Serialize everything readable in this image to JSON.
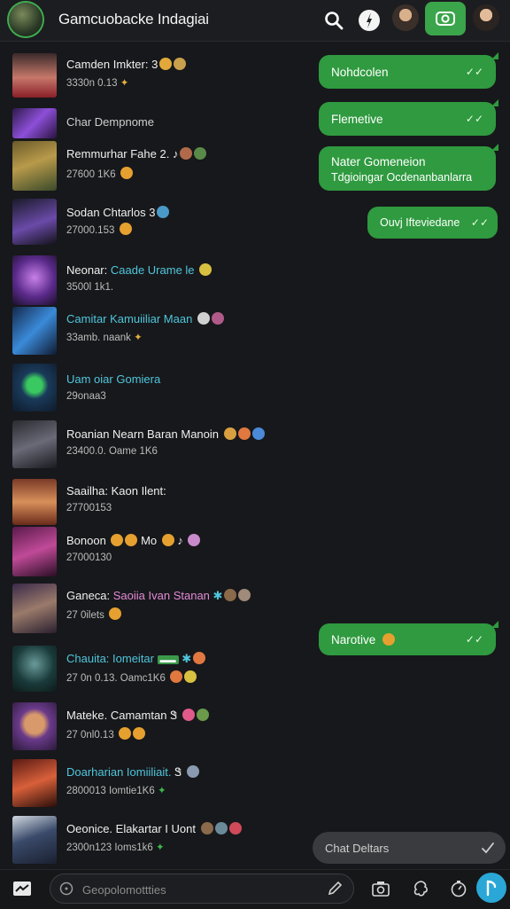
{
  "header": {
    "title": "Gamcuobacke Indagiai",
    "icons": [
      "search-icon",
      "compass-icon",
      "profile-avatar",
      "video-call-icon",
      "profile-avatar"
    ]
  },
  "chats": [
    {
      "name": "Camden Imkter:",
      "sub": "3330n 0.13",
      "thumb": "portrait-woman"
    },
    {
      "name": "Char Dempnome",
      "sub": "",
      "thumb": "purple-art"
    },
    {
      "name": "Remmurhar Fahe 2.",
      "sub": "27600 1K6",
      "thumb": "warrior-art"
    },
    {
      "name": "Sodan Chtarlos",
      "sub": "27000.153",
      "thumb": "weapon-art"
    },
    {
      "name": "Neonar: ",
      "name_accent": "Caade Urame le",
      "sub": "3500l 1k1.",
      "thumb": "mage-art"
    },
    {
      "name": "",
      "name_accent": "Camitar Kamuiiliar Maan",
      "sub": "33amb.   naank",
      "thumb": "lightning-art"
    },
    {
      "name": "",
      "name_accent": "Uam oiar Gomiera",
      "sub": "29onaa3",
      "thumb": "alien-art"
    },
    {
      "name": "Roanian Nearn Baran Manoin",
      "sub": "23400.0.   Oame 1K6",
      "thumb": "knight-art"
    },
    {
      "name": "Saailha: Kaon Ilent:",
      "sub": "27700153",
      "thumb": "soldier-art"
    },
    {
      "name": "Bonoon",
      "sub": "27000130",
      "thumb": "hero-art"
    },
    {
      "name": "Ganeca: ",
      "name_accent": "Saoiia Ivan Stanan",
      "sub": "27 0ilets",
      "thumb": "archer-art"
    },
    {
      "name": "",
      "name_accent": "Chauita: Iomeitar",
      "sub": "27 0n 0.13.   Oamc1K6",
      "thumb": "cyborg-art"
    },
    {
      "name": "Mateke. Camamtan",
      "sub": "27 0nl0.13",
      "thumb": "cartoon-art"
    },
    {
      "name": "",
      "name_accent": "Doarharian Iomiiliait.",
      "sub": "2800013   Iomtie1K6",
      "thumb": "fire-art"
    },
    {
      "name": "Oeonice. Elakartar I Uont",
      "sub": "2300n123   Ioms1k6",
      "thumb": "robot-art"
    }
  ],
  "bubbles": [
    {
      "line1": "Nohdcolen",
      "line2": "",
      "ticks": "✓✓"
    },
    {
      "line1": "Flemetive",
      "line2": "",
      "ticks": "✓✓"
    },
    {
      "line1": "Nater Gomeneion",
      "line2": "Tdgioingar Ocdenanbanlarra",
      "ticks": ""
    },
    {
      "line1": "Ouvj Ifteviedane",
      "line2": "",
      "ticks": "✓✓"
    },
    {
      "line1": "Narotive",
      "line2": "",
      "ticks": "✓✓"
    }
  ],
  "chat_details": {
    "label": "Chat Deltars"
  },
  "composer": {
    "placeholder": "Geopolomottties"
  },
  "colors": {
    "accent_green": "#2f9a3f",
    "send_blue": "#2aa7d6",
    "cyan_name": "#4fc6dc",
    "background": "#17181b"
  }
}
